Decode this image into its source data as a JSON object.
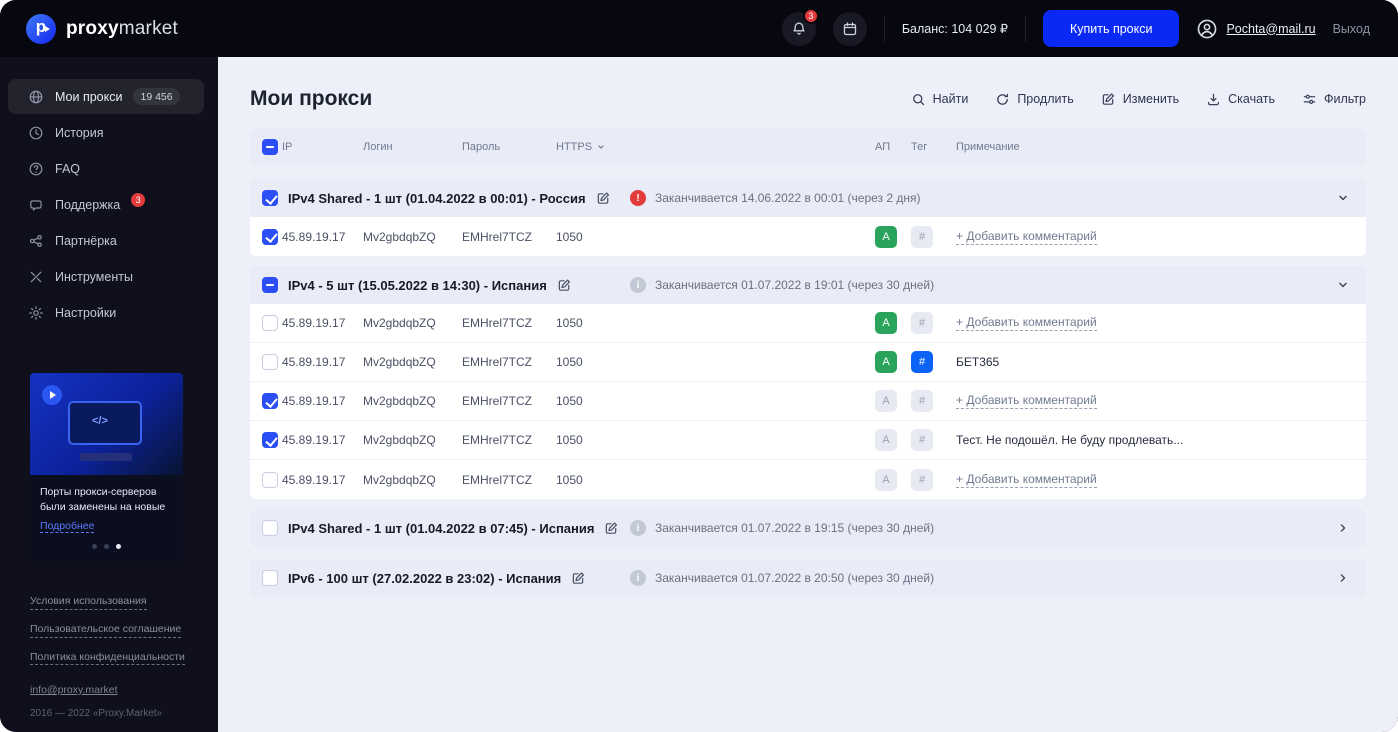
{
  "header": {
    "logo_bold": "proxy",
    "logo_light": "market",
    "notif_count": "3",
    "balance": "Баланс: 104 029 ₽",
    "buy_button": "Купить прокси",
    "user_email": "Pochta@mail.ru",
    "logout": "Выход"
  },
  "sidebar": {
    "items": [
      {
        "label": "Мои прокси",
        "badge": "19 456"
      },
      {
        "label": "История"
      },
      {
        "label": "FAQ"
      },
      {
        "label": "Поддержка",
        "badge": "3"
      },
      {
        "label": "Партнёрка"
      },
      {
        "label": "Инструменты"
      },
      {
        "label": "Настройки"
      }
    ],
    "promo": {
      "text": "Порты прокси-серверов были заменены на новые",
      "link": "Подробнее"
    },
    "links": [
      "Условия использования",
      "Пользовательское соглашение",
      "Политика конфиденциальности"
    ],
    "email": "info@proxy.market",
    "copyright": "2016 — 2022 «Proxy.Market»"
  },
  "main": {
    "title": "Мои прокси",
    "toolbar": {
      "search": "Найти",
      "renew": "Продлить",
      "edit": "Изменить",
      "download": "Скачать",
      "filter": "Фильтр"
    },
    "columns": {
      "ip": "IP",
      "login": "Логин",
      "password": "Пароль",
      "https": "HTTPS",
      "ap": "АП",
      "tag": "Тег",
      "note": "Примечание"
    },
    "header_cb": "minus",
    "badges": {
      "ap": "A",
      "tag": "#"
    },
    "groups": [
      {
        "cb": "checked",
        "title": "IPv4 Shared - 1 шт (01.04.2022 в 00:01) - Россия",
        "status_icon": "alert",
        "status_mark": "!",
        "status": "Заканчивается 14.06.2022 в 00:01 (через 2 дня)",
        "rows": [
          {
            "cb": "checked",
            "ip": "45.89.19.17",
            "login": "Mv2gbdqbZQ",
            "password": "EMHrel7TCZ",
            "port": "1050",
            "ap": "on",
            "tag": "",
            "note": "+ Добавить комментарий",
            "note_style": "link"
          }
        ]
      },
      {
        "cb": "minus",
        "title": "IPv4 - 5 шт (15.05.2022 в 14:30) - Испания",
        "status_icon": "info",
        "status_mark": "i",
        "status": "Заканчивается 01.07.2022 в 19:01 (через 30 дней)",
        "rows": [
          {
            "cb": "",
            "ip": "45.89.19.17",
            "login": "Mv2gbdqbZQ",
            "password": "EMHrel7TCZ",
            "port": "1050",
            "ap": "on",
            "tag": "",
            "note": "+ Добавить комментарий",
            "note_style": "link"
          },
          {
            "cb": "",
            "ip": "45.89.19.17",
            "login": "Mv2gbdqbZQ",
            "password": "EMHrel7TCZ",
            "port": "1050",
            "ap": "on",
            "tag": "blue",
            "note": "БЕТ365",
            "note_style": "text"
          },
          {
            "cb": "checked",
            "ip": "45.89.19.17",
            "login": "Mv2gbdqbZQ",
            "password": "EMHrel7TCZ",
            "port": "1050",
            "ap": "",
            "tag": "",
            "note": "+ Добавить комментарий",
            "note_style": "link"
          },
          {
            "cb": "checked",
            "ip": "45.89.19.17",
            "login": "Mv2gbdqbZQ",
            "password": "EMHrel7TCZ",
            "port": "1050",
            "ap": "",
            "tag": "",
            "note": "Тест. Не подошёл. Не буду продлевать...",
            "note_style": "text"
          },
          {
            "cb": "",
            "ip": "45.89.19.17",
            "login": "Mv2gbdqbZQ",
            "password": "EMHrel7TCZ",
            "port": "1050",
            "ap": "",
            "tag": "",
            "note": "+ Добавить комментарий",
            "note_style": "link"
          }
        ]
      },
      {
        "cb": "",
        "title": "IPv4 Shared - 1 шт (01.04.2022 в 07:45) - Испания",
        "status_icon": "info",
        "status_mark": "i",
        "status": "Заканчивается 01.07.2022 в 19:15 (через 30 дней)"
      },
      {
        "cb": "",
        "title": "IPv6 - 100 шт (27.02.2022 в 23:02) - Испания",
        "status_icon": "info",
        "status_mark": "i",
        "status": "Заканчивается 01.07.2022 в 20:50 (через 30 дней)"
      }
    ]
  }
}
